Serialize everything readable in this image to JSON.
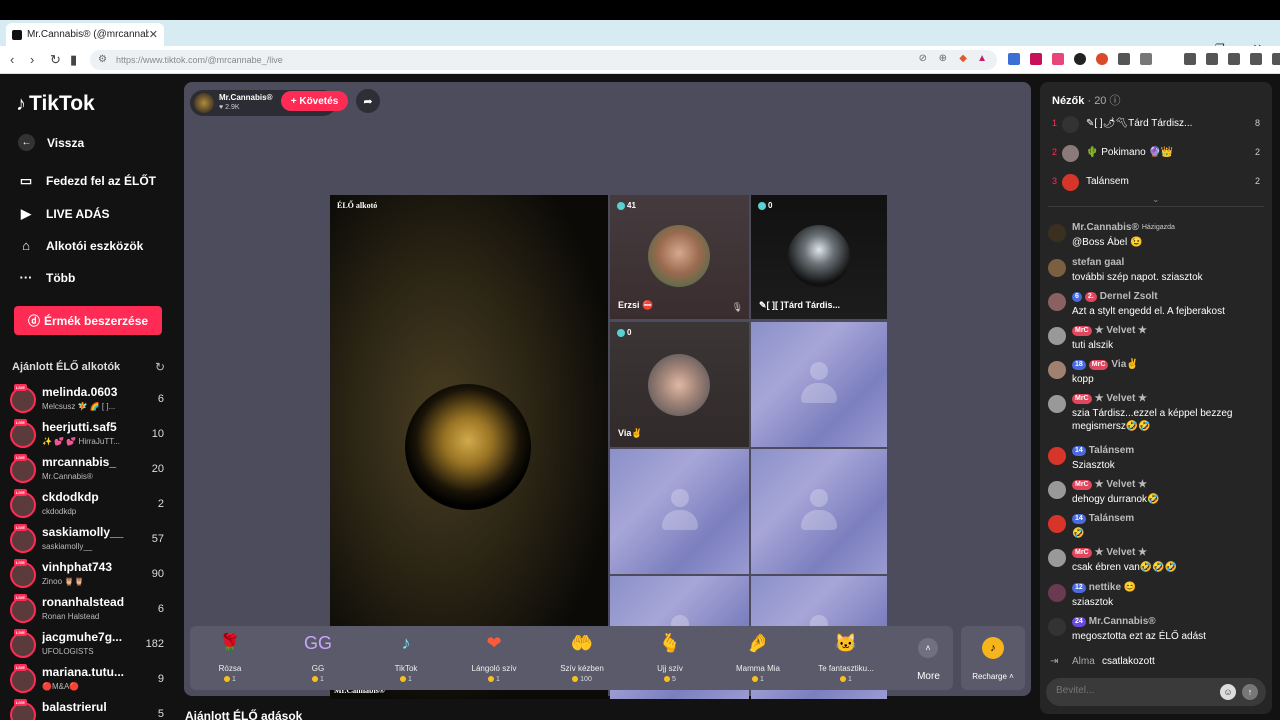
{
  "browser": {
    "tab_title": "Mr.Cannabis® (@mrcannabi...",
    "url": "https://www.tiktok.com/@mrcannabe_/live"
  },
  "sidebar": {
    "logo": "TikTok",
    "nav": [
      {
        "label": "Vissza"
      },
      {
        "label": "Fedezd fel az ÉLŐT"
      },
      {
        "label": "LIVE ADÁS"
      },
      {
        "label": "Alkotói eszközök"
      },
      {
        "label": "Több"
      }
    ],
    "coins_button": "Érmék beszerzése",
    "suggested_title": "Ajánlott ÉLŐ alkotók",
    "creators": [
      {
        "name": "melinda.0603",
        "sub": "Melcsusz 🧚 🌈 [ ]...",
        "count": "6"
      },
      {
        "name": "heerjutti.saf5",
        "sub": "✨ 💕 💕 HirraJuTT...",
        "count": "10"
      },
      {
        "name": "mrcannabis_",
        "sub": "Mr.Cannabis®",
        "count": "20"
      },
      {
        "name": "ckdodkdp",
        "sub": "ckdodkdp",
        "count": "2"
      },
      {
        "name": "saskiamolly__",
        "sub": "saskiamolly__",
        "count": "57"
      },
      {
        "name": "vinhphat743",
        "sub": "Zinoo 🦉🦉",
        "count": "90"
      },
      {
        "name": "ronanhalstead",
        "sub": "Ronan Halstead",
        "count": "6"
      },
      {
        "name": "jacgmuhe7g...",
        "sub": "UFOLOGISTS",
        "count": "182"
      },
      {
        "name": "mariana.tutu...",
        "sub": "🔴M&A🔴",
        "count": "9"
      },
      {
        "name": "balastrierul",
        "sub": "",
        "count": "5"
      }
    ]
  },
  "stream": {
    "host_name": "Mr.Cannabis®",
    "host_likes": "♥ 2.9K",
    "follow": "+ Követés",
    "main_label": "ÉLŐ alkotó",
    "main_name": "Mr.Cannabis®",
    "guests": [
      {
        "count": "41",
        "name": "Erzsi ⛔"
      },
      {
        "count": "0",
        "name": "✎[ ][ ]Tárd Tárdis..."
      },
      {
        "count": "0",
        "name": "Via✌"
      }
    ]
  },
  "gifts": [
    {
      "name": "Rózsa",
      "price": "1",
      "icon": "🌹"
    },
    {
      "name": "GG",
      "price": "1",
      "icon": "GG"
    },
    {
      "name": "TikTok",
      "price": "1",
      "icon": "♪"
    },
    {
      "name": "Lángoló szív",
      "price": "1",
      "icon": "❤"
    },
    {
      "name": "Szív kézben",
      "price": "100",
      "icon": "🤲"
    },
    {
      "name": "Ujj szív",
      "price": "5",
      "icon": "🫰"
    },
    {
      "name": "Mamma Mia",
      "price": "1",
      "icon": "🤌"
    },
    {
      "name": "Te fantasztiku...",
      "price": "1",
      "icon": "🐱"
    }
  ],
  "more_label": "More",
  "recharge_label": "Recharge ˄",
  "recommended_title": "Ajánlott ÉLŐ adások",
  "viewers": {
    "title": "Nézők",
    "count": "· 20",
    "list": [
      {
        "rank": "1",
        "name": "✎[ ]🌶〽Tárd Tárdisz...",
        "score": "8"
      },
      {
        "rank": "2",
        "name": "🌵 Pokimano 🔮👑",
        "score": "2"
      },
      {
        "rank": "3",
        "name": "Talánsem",
        "score": "2"
      }
    ]
  },
  "messages": [
    {
      "user": "Mr.Cannabis®",
      "badges": [],
      "host": "Házigazda",
      "text": "@Boss Ábel 😉"
    },
    {
      "user": "stefan gaal",
      "badges": [],
      "text": "további szép napot. sziasztok"
    },
    {
      "user": "Dernel Zsolt",
      "badges": [
        {
          "t": "6",
          "c": "bl"
        },
        {
          "t": "2.",
          "c": "br"
        }
      ],
      "text": "Azt a stylt engedd el. A fejberakost"
    },
    {
      "user": "★ Velvet ★",
      "badges": [
        {
          "t": "MrC",
          "c": "br"
        }
      ],
      "text": "tuti alszik"
    },
    {
      "user": "Via✌",
      "badges": [
        {
          "t": "18",
          "c": "bl"
        },
        {
          "t": "MrC",
          "c": "br"
        }
      ],
      "text": "kopp"
    },
    {
      "user": "★ Velvet ★",
      "badges": [
        {
          "t": "MrC",
          "c": "br"
        }
      ],
      "text": "szia Tárdisz...ezzel a képpel bezzeg megismersz🤣🤣"
    },
    {
      "user": "Talánsem",
      "badges": [
        {
          "t": "14",
          "c": "bl"
        }
      ],
      "text": "Sziasztok"
    },
    {
      "user": "★ Velvet ★",
      "badges": [
        {
          "t": "MrC",
          "c": "br"
        }
      ],
      "text": "dehogy durranok🤣"
    },
    {
      "user": "Talánsem",
      "badges": [
        {
          "t": "14",
          "c": "bl"
        }
      ],
      "text": "🤣"
    },
    {
      "user": "★ Velvet ★",
      "badges": [
        {
          "t": "MrC",
          "c": "br"
        }
      ],
      "text": "csak ébren van🤣🤣🤣"
    },
    {
      "user": "nettike 😊",
      "badges": [
        {
          "t": "12",
          "c": "bl"
        }
      ],
      "text": "sziasztok"
    },
    {
      "user": "Mr.Cannabis®",
      "badges": [
        {
          "t": "24",
          "c": "bp"
        }
      ],
      "text": "megosztotta ezt az ÉLŐ adást"
    }
  ],
  "joined": {
    "user": "Alma",
    "text": "csatlakozott"
  },
  "input_placeholder": "Bevitel..."
}
